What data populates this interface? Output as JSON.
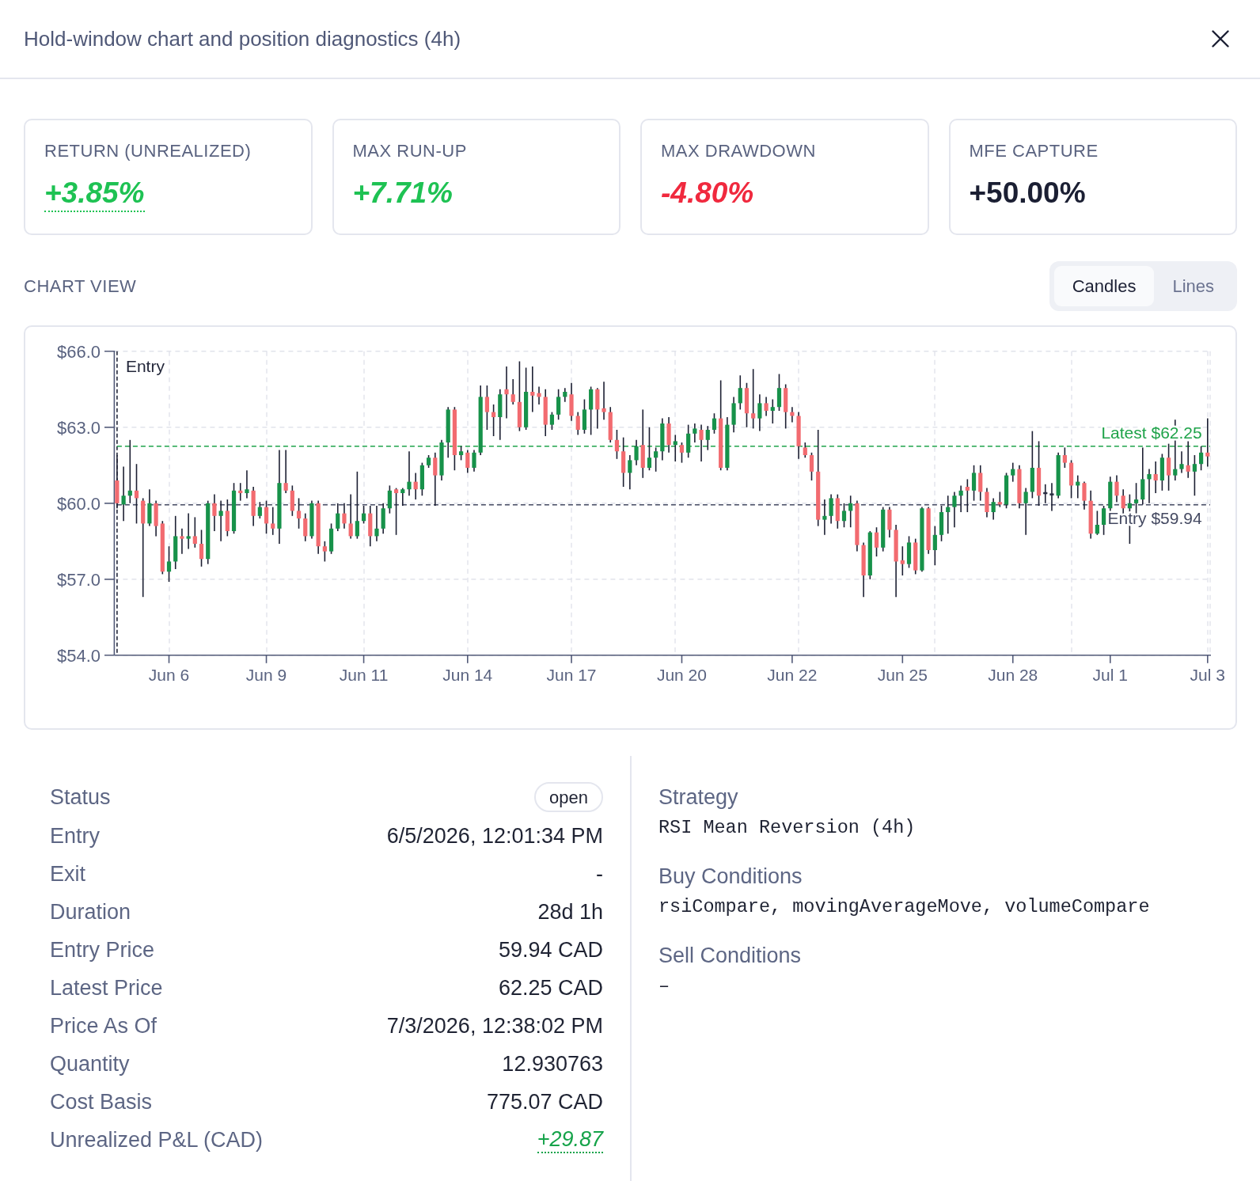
{
  "dialog": {
    "title": "Hold-window chart and position diagnostics (4h)"
  },
  "metrics": [
    {
      "label": "RETURN (UNREALIZED)",
      "value": "+3.85%",
      "color": "#1ec253",
      "italic": true,
      "underlined": true
    },
    {
      "label": "MAX RUN-UP",
      "value": "+7.71%",
      "color": "#1ec253",
      "italic": true,
      "underlined": false
    },
    {
      "label": "MAX DRAWDOWN",
      "value": "-4.80%",
      "color": "#f0293e",
      "italic": true,
      "underlined": false
    },
    {
      "label": "MFE CAPTURE",
      "value": "+50.00%",
      "color": "#1b1f33",
      "italic": false,
      "underlined": false
    }
  ],
  "chart_view": {
    "label": "CHART VIEW",
    "options": [
      {
        "label": "Candles",
        "selected": true
      },
      {
        "label": "Lines",
        "selected": false
      }
    ]
  },
  "chart": {
    "entry_marker": {
      "label": "Entry"
    },
    "chart_data": {
      "type": "candlestick",
      "categories": [
        null,
        null,
        null,
        null,
        null,
        null,
        null,
        null,
        "Jun 6",
        null,
        null,
        null,
        null,
        null,
        null,
        null,
        null,
        null,
        null,
        null,
        null,
        null,
        null,
        "Jun 9",
        null,
        null,
        null,
        null,
        null,
        null,
        null,
        null,
        null,
        null,
        null,
        null,
        null,
        null,
        "Jun 11",
        null,
        null,
        null,
        null,
        null,
        null,
        null,
        null,
        null,
        null,
        null,
        null,
        null,
        null,
        null,
        "Jun 14",
        null,
        null,
        null,
        null,
        null,
        null,
        null,
        null,
        null,
        null,
        null,
        null,
        null,
        null,
        null,
        "Jun 17",
        null,
        null,
        null,
        null,
        null,
        null,
        null,
        null,
        null,
        null,
        null,
        null,
        null,
        null,
        null,
        null,
        "Jun 20",
        null,
        null,
        null,
        null,
        null,
        null,
        null,
        null,
        null,
        null,
        null,
        null,
        null,
        null,
        null,
        null,
        "Jun 22",
        null,
        null,
        null,
        null,
        null,
        null,
        null,
        null,
        null,
        null,
        null,
        null,
        null,
        null,
        null,
        null,
        "Jun 25",
        null,
        null,
        null,
        null,
        null,
        null,
        null,
        null,
        null,
        null,
        null,
        null,
        null,
        null,
        null,
        null,
        "Jun 28",
        null,
        null,
        null,
        null,
        null,
        null,
        null,
        null,
        null,
        null,
        null,
        null,
        null,
        null,
        "Jul 1",
        null,
        null,
        null,
        null,
        null,
        null,
        null,
        null,
        null,
        null,
        null,
        null,
        null,
        null,
        "Jul 3"
      ],
      "ohlc": [
        [
          60.9,
          61.9,
          59.8,
          60.0
        ],
        [
          59.95,
          61.45,
          59.3,
          60.3
        ],
        [
          60.3,
          62.5,
          60.0,
          60.5
        ],
        [
          60.5,
          61.55,
          59.2,
          60.2
        ],
        [
          60.1,
          60.2,
          56.3,
          59.2
        ],
        [
          59.2,
          60.55,
          59.1,
          60.0
        ],
        [
          60.0,
          60.1,
          58.7,
          59.1
        ],
        [
          59.2,
          59.3,
          57.2,
          57.3
        ],
        [
          57.3,
          58.3,
          56.9,
          57.7
        ],
        [
          57.7,
          59.5,
          57.4,
          58.7
        ],
        [
          58.7,
          59.0,
          58.0,
          58.6
        ],
        [
          58.6,
          59.6,
          58.2,
          58.7
        ],
        [
          58.7,
          59.45,
          58.25,
          58.4
        ],
        [
          58.4,
          58.95,
          57.5,
          57.8
        ],
        [
          57.8,
          60.1,
          57.6,
          60.0
        ],
        [
          60.0,
          60.35,
          58.9,
          59.5
        ],
        [
          59.5,
          60.1,
          58.5,
          59.7
        ],
        [
          59.7,
          60.15,
          58.7,
          58.9
        ],
        [
          58.9,
          60.8,
          58.8,
          60.5
        ],
        [
          60.5,
          60.8,
          60.1,
          60.4
        ],
        [
          60.4,
          61.3,
          60.2,
          60.55
        ],
        [
          60.5,
          60.65,
          59.1,
          59.5
        ],
        [
          59.5,
          60.05,
          59.4,
          59.85
        ],
        [
          59.85,
          60.1,
          58.8,
          59.2
        ],
        [
          59.2,
          59.85,
          58.75,
          59.0
        ],
        [
          59.0,
          62.1,
          58.4,
          60.8
        ],
        [
          60.8,
          62.1,
          60.4,
          60.5
        ],
        [
          60.5,
          60.7,
          59.5,
          59.7
        ],
        [
          59.7,
          60.2,
          59.0,
          59.4
        ],
        [
          59.4,
          59.6,
          58.5,
          58.7
        ],
        [
          58.7,
          60.1,
          58.6,
          60.0
        ],
        [
          60.0,
          60.1,
          58.0,
          58.3
        ],
        [
          58.3,
          58.5,
          57.7,
          58.1
        ],
        [
          58.1,
          59.2,
          58.0,
          59.0
        ],
        [
          59.0,
          60.0,
          58.9,
          59.6
        ],
        [
          59.6,
          60.0,
          59.0,
          59.2
        ],
        [
          59.2,
          60.35,
          58.6,
          58.7
        ],
        [
          58.7,
          61.25,
          58.6,
          59.3
        ],
        [
          59.3,
          59.9,
          59.2,
          59.6
        ],
        [
          59.6,
          59.9,
          58.3,
          58.7
        ],
        [
          58.7,
          59.9,
          58.5,
          59.0
        ],
        [
          59.0,
          60.0,
          58.8,
          59.8
        ],
        [
          59.8,
          60.7,
          59.6,
          60.5
        ],
        [
          60.55,
          60.6,
          58.75,
          60.4
        ],
        [
          60.4,
          60.6,
          59.9,
          60.55
        ],
        [
          60.55,
          62.05,
          60.3,
          60.85
        ],
        [
          60.85,
          61.2,
          60.15,
          60.55
        ],
        [
          60.55,
          61.6,
          60.3,
          61.5
        ],
        [
          61.5,
          61.9,
          61.4,
          61.8
        ],
        [
          61.8,
          62.0,
          59.9,
          61.1
        ],
        [
          61.1,
          62.5,
          60.9,
          62.4
        ],
        [
          62.4,
          63.8,
          61.8,
          63.7
        ],
        [
          63.7,
          63.8,
          61.3,
          61.9
        ],
        [
          61.9,
          62.25,
          61.7,
          62.05
        ],
        [
          62.0,
          62.1,
          61.2,
          61.4
        ],
        [
          61.4,
          62.1,
          61.25,
          62.0
        ],
        [
          62.0,
          64.65,
          61.9,
          64.2
        ],
        [
          64.2,
          64.65,
          62.9,
          63.6
        ],
        [
          63.6,
          63.9,
          62.65,
          63.4
        ],
        [
          63.4,
          64.5,
          62.5,
          64.3
        ],
        [
          64.5,
          65.4,
          63.35,
          64.3
        ],
        [
          64.3,
          64.9,
          63.9,
          64.0
        ],
        [
          64.0,
          65.6,
          62.85,
          63.0
        ],
        [
          63.0,
          65.35,
          62.9,
          64.4
        ],
        [
          64.4,
          65.4,
          63.6,
          64.25
        ],
        [
          64.35,
          64.6,
          63.9,
          64.2
        ],
        [
          64.2,
          64.5,
          62.65,
          63.1
        ],
        [
          63.1,
          63.6,
          62.9,
          63.5
        ],
        [
          63.5,
          64.5,
          63.3,
          64.2
        ],
        [
          64.2,
          64.55,
          64.0,
          64.4
        ],
        [
          64.3,
          64.75,
          63.25,
          63.45
        ],
        [
          63.45,
          63.6,
          62.7,
          62.9
        ],
        [
          62.9,
          64.1,
          62.75,
          63.7
        ],
        [
          63.7,
          64.6,
          62.7,
          64.5
        ],
        [
          64.5,
          64.55,
          62.95,
          63.7
        ],
        [
          63.75,
          64.8,
          63.3,
          63.6
        ],
        [
          63.6,
          63.8,
          62.4,
          62.5
        ],
        [
          62.5,
          62.9,
          61.75,
          62.05
        ],
        [
          62.05,
          62.6,
          60.65,
          61.2
        ],
        [
          61.2,
          61.9,
          60.55,
          61.7
        ],
        [
          61.7,
          62.5,
          61.5,
          62.25
        ],
        [
          62.3,
          63.7,
          61.0,
          61.4
        ],
        [
          61.4,
          63.0,
          61.3,
          61.8
        ],
        [
          61.8,
          62.2,
          61.25,
          62.05
        ],
        [
          62.05,
          63.35,
          61.7,
          63.15
        ],
        [
          63.15,
          63.4,
          62.0,
          62.3
        ],
        [
          62.3,
          62.7,
          61.65,
          62.45
        ],
        [
          62.3,
          62.4,
          61.6,
          62.0
        ],
        [
          62.0,
          63.1,
          61.8,
          62.75
        ],
        [
          62.75,
          63.15,
          62.4,
          62.95
        ],
        [
          62.9,
          63.1,
          61.65,
          62.5
        ],
        [
          62.5,
          63.05,
          62.1,
          62.9
        ],
        [
          62.9,
          63.55,
          62.75,
          63.35
        ],
        [
          63.35,
          64.85,
          61.3,
          61.4
        ],
        [
          61.4,
          63.4,
          61.3,
          63.1
        ],
        [
          63.1,
          64.2,
          62.8,
          63.95
        ],
        [
          63.95,
          65.05,
          63.7,
          64.55
        ],
        [
          64.55,
          64.75,
          63.0,
          63.55
        ],
        [
          63.55,
          65.3,
          62.95,
          63.35
        ],
        [
          63.35,
          64.3,
          62.85,
          63.95
        ],
        [
          63.95,
          64.2,
          63.45,
          63.65
        ],
        [
          63.65,
          64.1,
          63.15,
          63.8
        ],
        [
          63.8,
          65.1,
          63.65,
          64.55
        ],
        [
          64.55,
          64.7,
          62.95,
          63.6
        ],
        [
          63.6,
          63.8,
          63.2,
          63.45
        ],
        [
          63.45,
          63.6,
          61.75,
          62.25
        ],
        [
          62.2,
          62.4,
          61.8,
          61.9
        ],
        [
          61.9,
          62.0,
          60.9,
          61.25
        ],
        [
          61.25,
          62.9,
          59.1,
          59.35
        ],
        [
          59.35,
          60.15,
          58.75,
          59.5
        ],
        [
          59.5,
          60.35,
          59.2,
          60.2
        ],
        [
          60.2,
          60.35,
          59.0,
          59.3
        ],
        [
          59.3,
          60.0,
          59.05,
          59.7
        ],
        [
          59.7,
          60.3,
          59.05,
          60.0
        ],
        [
          60.0,
          60.1,
          58.1,
          58.35
        ],
        [
          58.35,
          58.45,
          56.3,
          57.15
        ],
        [
          57.15,
          58.9,
          57.0,
          58.85
        ],
        [
          58.85,
          59.05,
          57.9,
          58.25
        ],
        [
          58.25,
          59.85,
          58.1,
          59.75
        ],
        [
          59.75,
          59.85,
          58.65,
          58.95
        ],
        [
          58.95,
          59.15,
          56.3,
          57.7
        ],
        [
          57.75,
          58.3,
          57.15,
          57.6
        ],
        [
          57.6,
          58.7,
          57.45,
          58.45
        ],
        [
          58.45,
          58.6,
          57.2,
          57.35
        ],
        [
          57.35,
          59.85,
          57.3,
          59.8
        ],
        [
          59.8,
          59.85,
          58.0,
          58.15
        ],
        [
          58.15,
          59.1,
          57.55,
          58.75
        ],
        [
          58.75,
          59.9,
          58.5,
          59.65
        ],
        [
          59.65,
          60.3,
          58.8,
          59.85
        ],
        [
          59.85,
          60.45,
          59.05,
          60.3
        ],
        [
          60.3,
          60.7,
          59.65,
          60.5
        ],
        [
          60.65,
          60.95,
          59.65,
          60.5
        ],
        [
          60.5,
          61.5,
          60.1,
          61.2
        ],
        [
          61.2,
          61.5,
          60.1,
          60.45
        ],
        [
          60.45,
          60.6,
          59.45,
          59.65
        ],
        [
          59.65,
          60.2,
          59.35,
          60.05
        ],
        [
          60.05,
          60.45,
          59.85,
          59.95
        ],
        [
          59.95,
          61.2,
          59.8,
          61.1
        ],
        [
          61.1,
          61.6,
          60.85,
          61.35
        ],
        [
          61.35,
          61.5,
          59.8,
          60.0
        ],
        [
          60.0,
          60.6,
          58.75,
          60.45
        ],
        [
          60.45,
          62.85,
          60.2,
          61.4
        ],
        [
          61.4,
          62.45,
          59.9,
          60.3
        ],
        [
          60.4,
          60.75,
          60.0,
          60.4
        ],
        [
          60.35,
          60.8,
          59.7,
          60.35
        ],
        [
          60.3,
          62.0,
          60.2,
          61.9
        ],
        [
          61.9,
          62.2,
          61.4,
          61.6
        ],
        [
          61.6,
          61.7,
          60.2,
          60.7
        ],
        [
          60.7,
          61.1,
          60.2,
          60.85
        ],
        [
          60.8,
          60.85,
          59.75,
          60.1
        ],
        [
          60.1,
          60.5,
          58.6,
          58.8
        ],
        [
          58.8,
          59.7,
          58.75,
          59.15
        ],
        [
          59.15,
          59.9,
          58.75,
          59.8
        ],
        [
          59.8,
          61.05,
          59.2,
          60.85
        ],
        [
          60.85,
          61.1,
          60.05,
          60.3
        ],
        [
          60.3,
          60.55,
          59.5,
          59.8
        ],
        [
          59.8,
          60.35,
          58.4,
          60.0
        ],
        [
          60.0,
          60.8,
          59.55,
          60.15
        ],
        [
          60.15,
          62.2,
          59.95,
          60.95
        ],
        [
          60.95,
          61.35,
          60.0,
          61.15
        ],
        [
          61.15,
          61.65,
          60.4,
          60.9
        ],
        [
          60.9,
          61.95,
          60.5,
          61.8
        ],
        [
          61.8,
          62.35,
          60.5,
          61.1
        ],
        [
          61.1,
          63.3,
          60.9,
          61.35
        ],
        [
          61.35,
          62.05,
          61.2,
          61.55
        ],
        [
          61.5,
          62.45,
          61.0,
          61.25
        ],
        [
          61.25,
          61.9,
          60.3,
          61.55
        ],
        [
          61.55,
          62.25,
          61.3,
          62.0
        ],
        [
          62.0,
          63.35,
          61.45,
          61.85
        ]
      ],
      "ylim": [
        54,
        66
      ],
      "yticks": [
        {
          "value": 66,
          "label": "$66.0"
        },
        {
          "value": 63,
          "label": "$63.0"
        },
        {
          "value": 60,
          "label": "$60.0"
        },
        {
          "value": 57,
          "label": "$57.0"
        },
        {
          "value": 54,
          "label": "$54.0"
        }
      ],
      "grid": true,
      "ref_lines": [
        {
          "axis": "y",
          "value": 62.25,
          "label": "Latest $62.25",
          "color": "#1fa34a"
        },
        {
          "axis": "y",
          "value": 59.94,
          "label": "Entry $59.94",
          "color": "#454a62"
        }
      ]
    }
  },
  "position": [
    {
      "kind": "badge",
      "label": "Status",
      "value": "open"
    },
    {
      "kind": "text",
      "label": "Entry",
      "value": "6/5/2026, 12:01:34 PM"
    },
    {
      "kind": "text",
      "label": "Exit",
      "value": "-"
    },
    {
      "kind": "text",
      "label": "Duration",
      "value": "28d 1h"
    },
    {
      "kind": "text",
      "label": "Entry Price",
      "value": "59.94 CAD"
    },
    {
      "kind": "text",
      "label": "Latest Price",
      "value": "62.25 CAD"
    },
    {
      "kind": "text",
      "label": "Price As Of",
      "value": "7/3/2026, 12:38:02 PM"
    },
    {
      "kind": "text",
      "label": "Quantity",
      "value": "12.930763"
    },
    {
      "kind": "text",
      "label": "Cost Basis",
      "value": "775.07 CAD"
    },
    {
      "kind": "signed",
      "label": "Unrealized P&L (CAD)",
      "value": "+29.87",
      "color": "#16a34a"
    }
  ],
  "strategy": [
    {
      "label": "Strategy",
      "value": "RSI Mean Reversion (4h)"
    },
    {
      "label": "Buy Conditions",
      "value": "rsiCompare, movingAverageMove, volumeCompare"
    },
    {
      "label": "Sell Conditions",
      "value": "–"
    }
  ]
}
